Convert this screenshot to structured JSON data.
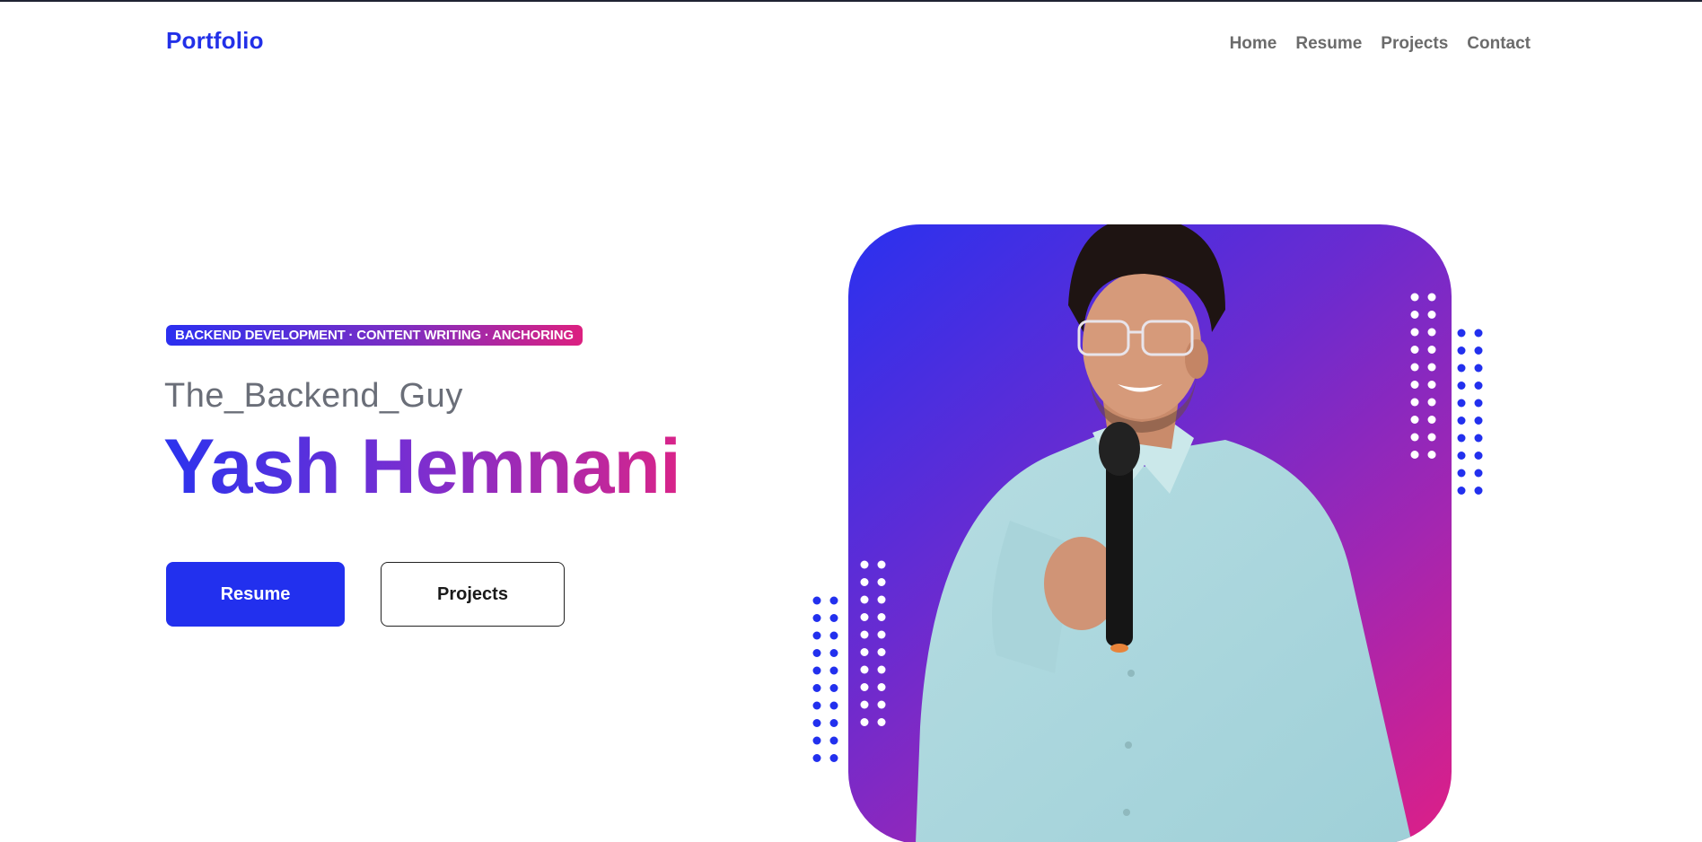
{
  "header": {
    "brand": "Portfolio",
    "nav": [
      {
        "label": "Home"
      },
      {
        "label": "Resume"
      },
      {
        "label": "Projects"
      },
      {
        "label": "Contact"
      }
    ]
  },
  "hero": {
    "tagline": "BACKEND DEVELOPMENT · CONTENT WRITING · ANCHORING",
    "handle": "The_Backend_Guy",
    "name": "Yash Hemnani",
    "buttons": {
      "resume": "Resume",
      "projects": "Projects"
    }
  },
  "colors": {
    "brand": "#2230e8",
    "gradient_start": "#2b31ef",
    "gradient_end": "#de1f86",
    "nav_text": "#6b6b6b",
    "dot_blue": "#2230ee",
    "dot_white": "#ffffff"
  }
}
